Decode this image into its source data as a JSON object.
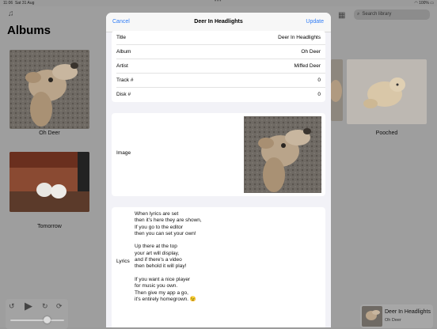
{
  "status_bar": {
    "time": "11:06",
    "date": "Sat 31 Aug",
    "battery": "100%"
  },
  "background": {
    "title": "Albums",
    "search_placeholder": "Search library",
    "albums": [
      {
        "name": "Oh Deer"
      },
      {
        "name": "Pooched"
      },
      {
        "name": "Tomorrow"
      }
    ],
    "now_playing": {
      "title": "Deer In Headlights",
      "album": "Oh Deer"
    }
  },
  "modal": {
    "cancel": "Cancel",
    "title": "Deer In Headlights",
    "update": "Update",
    "fields": [
      {
        "label": "Title",
        "value": "Deer In Headlights"
      },
      {
        "label": "Album",
        "value": "Oh Deer"
      },
      {
        "label": "Artist",
        "value": "Miffed Deer"
      },
      {
        "label": "Track #",
        "value": "0"
      },
      {
        "label": "Disk #",
        "value": "0"
      }
    ],
    "image_label": "Image",
    "lyrics_label": "Lyrics",
    "lyrics": [
      "When lyrics are set",
      "then it's here they are shown,",
      "If you go to the editor",
      "then you can set your own!",
      "",
      "Up there at the top",
      "your art will display,",
      "and if there's a video",
      "then behold it will play!",
      "",
      "If you want a nice player",
      "for music you own.",
      "Then give my app a go,",
      "it's entirely homegrown. 😉"
    ]
  },
  "colors": {
    "accent": "#2f7cf6",
    "sheet_bg": "#f2f2f7",
    "dimmed_bg": "#9e9e9e"
  }
}
